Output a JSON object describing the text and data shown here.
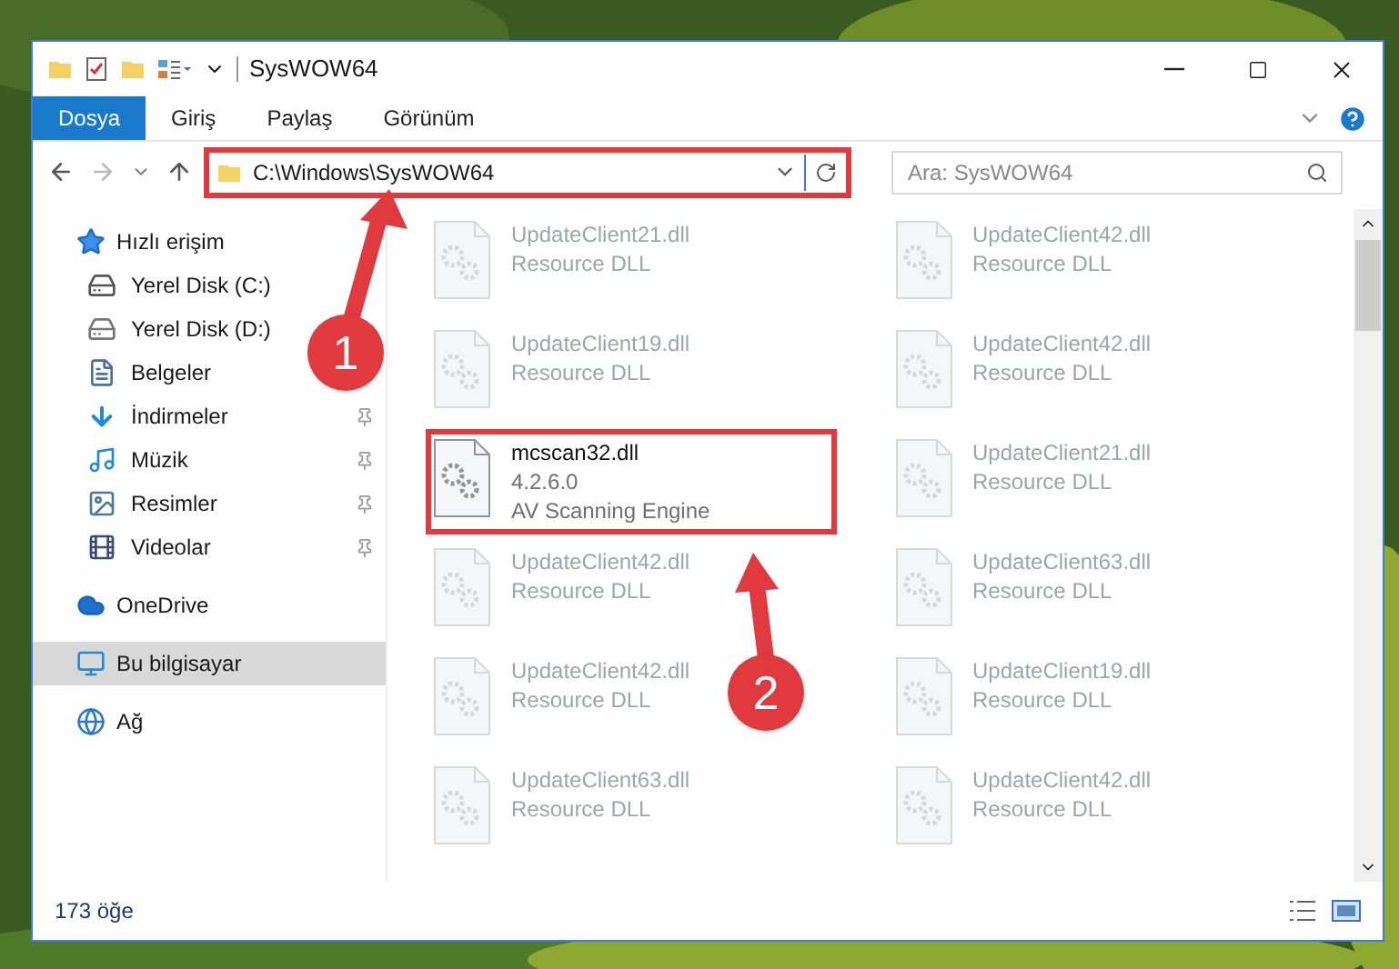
{
  "window": {
    "title": "SysWOW64"
  },
  "ribbon": {
    "tabs": [
      {
        "label": "Dosya",
        "selected": true
      },
      {
        "label": "Giriş",
        "selected": false
      },
      {
        "label": "Paylaş",
        "selected": false
      },
      {
        "label": "Görünüm",
        "selected": false
      }
    ]
  },
  "address": {
    "path": "C:\\Windows\\SysWOW64"
  },
  "search": {
    "placeholder": "Ara: SysWOW64"
  },
  "sidebar": {
    "items": [
      {
        "label": "Hızlı erişim",
        "kind": "star",
        "selected": false,
        "children": [
          {
            "label": "Yerel Disk (C:)",
            "kind": "system-drive"
          },
          {
            "label": "Yerel Disk (D:)",
            "kind": "drive"
          },
          {
            "label": "Belgeler",
            "kind": "documents"
          },
          {
            "label": "İndirmeler",
            "kind": "downloads",
            "pinned": true
          },
          {
            "label": "Müzik",
            "kind": "music",
            "pinned": true
          },
          {
            "label": "Resimler",
            "kind": "pictures",
            "pinned": true
          },
          {
            "label": "Videolar",
            "kind": "videos",
            "pinned": true
          }
        ]
      },
      {
        "label": "OneDrive",
        "kind": "cloud",
        "selected": false
      },
      {
        "label": "Bu bilgisayar",
        "kind": "computer",
        "selected": true
      },
      {
        "label": "Ağ",
        "kind": "network",
        "selected": false
      }
    ]
  },
  "files": [
    {
      "name": "UpdateClient21.dll",
      "lines": [
        "Resource DLL"
      ],
      "dimmed": true
    },
    {
      "name": "UpdateClient42.dll",
      "lines": [
        "Resource DLL"
      ],
      "dimmed": true
    },
    {
      "name": "UpdateClient19.dll",
      "lines": [
        "Resource DLL"
      ],
      "dimmed": true
    },
    {
      "name": "UpdateClient42.dll",
      "lines": [
        "Resource DLL"
      ],
      "dimmed": true
    },
    {
      "name": "mcscan32.dll",
      "lines": [
        "4.2.6.0",
        "AV Scanning Engine"
      ],
      "dimmed": false
    },
    {
      "name": "UpdateClient21.dll",
      "lines": [
        "Resource DLL"
      ],
      "dimmed": true
    },
    {
      "name": "UpdateClient42.dll",
      "lines": [
        "Resource DLL"
      ],
      "dimmed": true
    },
    {
      "name": "UpdateClient63.dll",
      "lines": [
        "Resource DLL"
      ],
      "dimmed": true
    },
    {
      "name": "UpdateClient42.dll",
      "lines": [
        "Resource DLL"
      ],
      "dimmed": true
    },
    {
      "name": "UpdateClient19.dll",
      "lines": [
        "Resource DLL"
      ],
      "dimmed": true
    },
    {
      "name": "UpdateClient63.dll",
      "lines": [
        "Resource DLL"
      ],
      "dimmed": true
    },
    {
      "name": "UpdateClient42.dll",
      "lines": [
        "Resource DLL"
      ],
      "dimmed": true
    }
  ],
  "status_bar": {
    "count": "173 öğe"
  },
  "annotations": [
    {
      "number": "1"
    },
    {
      "number": "2"
    }
  ]
}
